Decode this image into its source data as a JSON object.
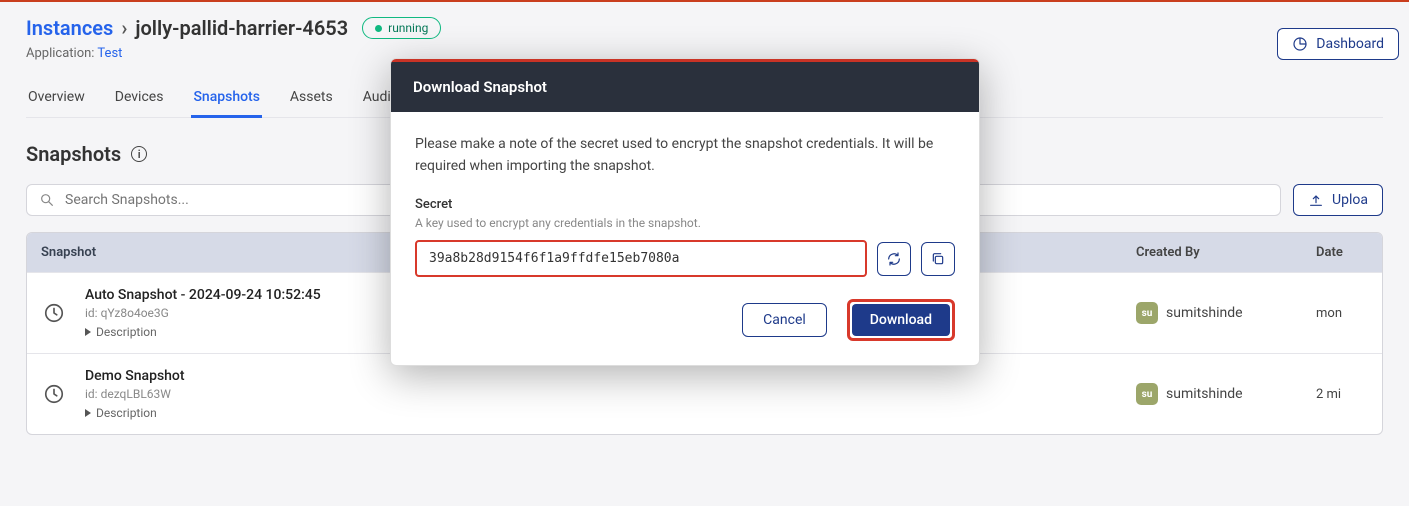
{
  "breadcrumb": {
    "root": "Instances",
    "leaf": "jolly-pallid-harrier-4653"
  },
  "status": "running",
  "application": {
    "label": "Application:",
    "name": "Test"
  },
  "tabs": [
    "Overview",
    "Devices",
    "Snapshots",
    "Assets",
    "Audit L"
  ],
  "active_tab_index": 2,
  "section_title": "Snapshots",
  "search": {
    "placeholder": "Search Snapshots..."
  },
  "buttons": {
    "dashboard": "Dashboard",
    "upload": "Uploa"
  },
  "table": {
    "headers": {
      "snapshot": "Snapshot",
      "created_by": "Created By",
      "date": "Date"
    },
    "rows": [
      {
        "name": "Auto Snapshot - 2024-09-24 10:52:45",
        "id": "id: qYz8o4oe3G",
        "desc_label": "Description",
        "created_by": "sumitshinde",
        "avatar": "su",
        "date": "mon"
      },
      {
        "name": "Demo Snapshot",
        "id": "id: dezqLBL63W",
        "desc_label": "Description",
        "created_by": "sumitshinde",
        "avatar": "su",
        "date": "2 mi"
      }
    ]
  },
  "modal": {
    "title": "Download Snapshot",
    "description": "Please make a note of the secret used to encrypt the snapshot credentials. It will be required when importing the snapshot.",
    "secret_label": "Secret",
    "secret_hint": "A key used to encrypt any credentials in the snapshot.",
    "secret_value": "39a8b28d9154f6f1a9ffdfe15eb7080a",
    "cancel": "Cancel",
    "download": "Download"
  }
}
